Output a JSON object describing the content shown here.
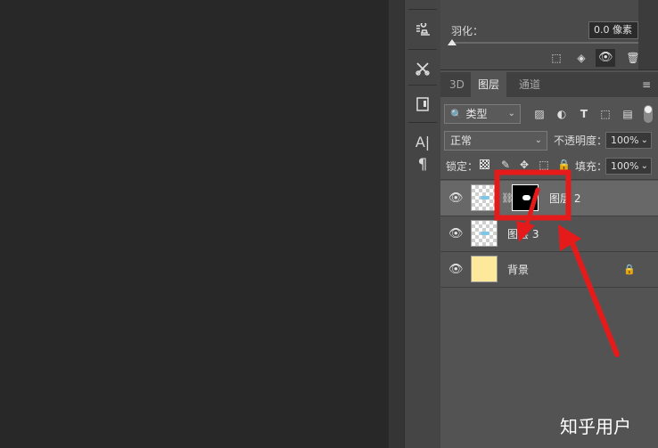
{
  "properties": {
    "feather_label": "羽化：",
    "feather_value": "0.0 像素",
    "slider_level": 0
  },
  "tools": [
    {
      "icon": "stamp-icon",
      "glyph": "⋮♟"
    },
    {
      "icon": "scissors-icon",
      "glyph": "✂"
    },
    {
      "icon": "panel-icon",
      "glyph": "▣"
    },
    {
      "icon": "character-icon",
      "glyph": "A|"
    },
    {
      "icon": "paragraph-icon",
      "glyph": "¶"
    }
  ],
  "tabs": {
    "tab_3d": "3D",
    "tab_layers": "图层",
    "tab_channels": "通道",
    "menu_glyph": "≡"
  },
  "filter": {
    "kind_label": "类型",
    "chevron": "⌄"
  },
  "blend": {
    "mode": "正常",
    "opacity_label": "不透明度：",
    "opacity_value": "100%",
    "chevron": "⌄"
  },
  "lock": {
    "label": "锁定：",
    "fill_label": "填充：",
    "fill_value": "100%"
  },
  "layers": [
    {
      "name": "图层 2",
      "selected": true
    },
    {
      "name": "图层 3",
      "selected": false
    },
    {
      "name": "背景",
      "selected": false,
      "locked": true
    }
  ],
  "watermark": "知乎用户",
  "colors": {
    "highlight": "#e51b1b",
    "background_layer": "#fde89b",
    "selected_row": "#686868"
  }
}
